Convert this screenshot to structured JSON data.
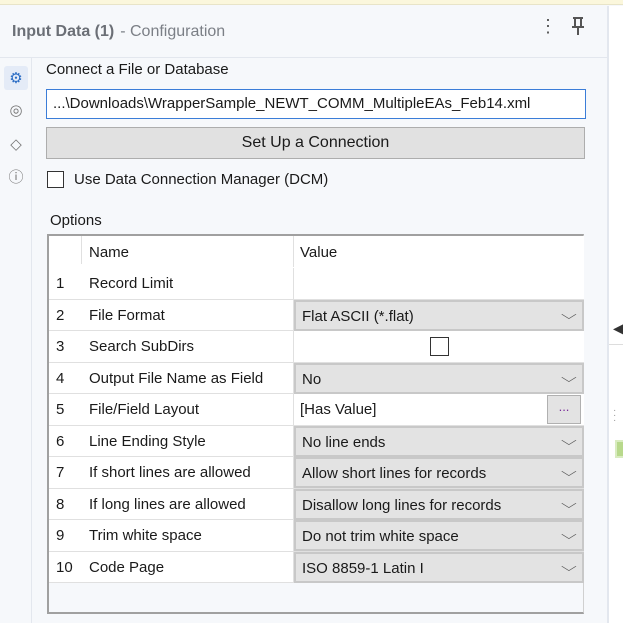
{
  "header": {
    "title": "Input Data (1)",
    "subtitle": "- Configuration"
  },
  "connect": {
    "label": "Connect a File or Database",
    "path": "...\\Downloads\\WrapperSample_NEWT_COMM_MultipleEAs_Feb14.xml",
    "button": "Set Up a Connection",
    "dcm_label": "Use Data Connection Manager (DCM)",
    "dcm_checked": false
  },
  "options": {
    "label": "Options",
    "col_name": "Name",
    "col_value": "Value",
    "rows": [
      {
        "num": "1",
        "name": "Record Limit",
        "value": "",
        "type": "text"
      },
      {
        "num": "2",
        "name": "File Format",
        "value": "Flat ASCII (*.flat)",
        "type": "dropdown"
      },
      {
        "num": "3",
        "name": "Search SubDirs",
        "value": "",
        "type": "checkbox"
      },
      {
        "num": "4",
        "name": "Output File Name as Field",
        "value": "No",
        "type": "dropdown"
      },
      {
        "num": "5",
        "name": "File/Field Layout",
        "value": "[Has Value]",
        "type": "ellipsis",
        "button": "..."
      },
      {
        "num": "6",
        "name": "Line Ending Style",
        "value": "No line ends",
        "type": "dropdown"
      },
      {
        "num": "7",
        "name": "If short lines are allowed",
        "value": "Allow short lines for records",
        "type": "dropdown"
      },
      {
        "num": "8",
        "name": "If long lines are allowed",
        "value": "Disallow long lines for records",
        "type": "dropdown"
      },
      {
        "num": "9",
        "name": "Trim white space",
        "value": "Do not trim white space",
        "type": "dropdown"
      },
      {
        "num": "10",
        "name": "Code Page",
        "value": "ISO 8859-1 Latin I",
        "type": "dropdown"
      }
    ]
  }
}
